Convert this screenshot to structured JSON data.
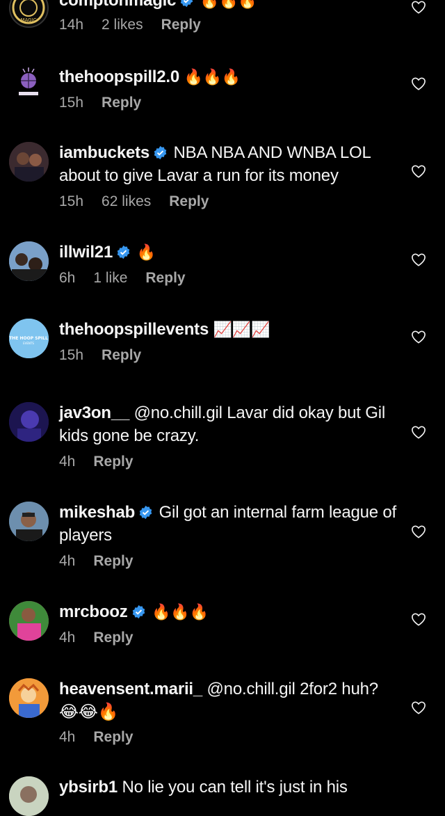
{
  "comments": [
    {
      "username": "comptonmagic",
      "verified": true,
      "text": "🔥🔥🔥",
      "time": "14h",
      "likes": "2 likes",
      "reply": "Reply",
      "avatar": {
        "kind": "crest",
        "bg": "#0a0a0a",
        "label": "MAGIC"
      }
    },
    {
      "username": "thehoopspill2.0",
      "verified": false,
      "text": "🔥🔥🔥",
      "time": "15h",
      "likes": "",
      "reply": "Reply",
      "avatar": {
        "kind": "ball",
        "bg": "#000000"
      }
    },
    {
      "username": "iambuckets",
      "verified": true,
      "text": "NBA NBA AND WNBA LOL about to give Lavar a run for its money",
      "time": "15h",
      "likes": "62 likes",
      "reply": "Reply",
      "avatar": {
        "kind": "photo",
        "bg": "#3b2a2f"
      }
    },
    {
      "username": "illwil21",
      "verified": true,
      "text": "🔥",
      "time": "6h",
      "likes": "1 like",
      "reply": "Reply",
      "avatar": {
        "kind": "photo",
        "bg": "#7aa0c8"
      }
    },
    {
      "username": "thehoopspillevents",
      "verified": false,
      "text": "📈📈📈",
      "time": "15h",
      "likes": "",
      "reply": "Reply",
      "avatar": {
        "kind": "text",
        "bg": "#7fc4ef",
        "label": "THE HOOP SPILL"
      }
    },
    {
      "username": "jav3on__",
      "verified": false,
      "text": "@no.chill.gil Lavar did okay but Gil kids gone be crazy.",
      "time": "4h",
      "likes": "",
      "reply": "Reply",
      "avatar": {
        "kind": "photo",
        "bg": "#2a1f6a"
      }
    },
    {
      "username": "mikeshab",
      "verified": true,
      "text": "Gil got an internal farm league of players",
      "time": "4h",
      "likes": "",
      "reply": "Reply",
      "avatar": {
        "kind": "photo",
        "bg": "#4a6a8a"
      }
    },
    {
      "username": "mrcbooz",
      "verified": true,
      "text": "🔥🔥🔥",
      "time": "4h",
      "likes": "",
      "reply": "Reply",
      "avatar": {
        "kind": "photo",
        "bg": "#d83a8a"
      }
    },
    {
      "username": "heavensent.marii_",
      "verified": false,
      "text": "@no.chill.gil 2for2 huh? 😂😂🔥",
      "time": "4h",
      "likes": "",
      "reply": "Reply",
      "avatar": {
        "kind": "cartoon",
        "bg": "#f28a2e"
      }
    },
    {
      "username": "ybsirb1",
      "verified": false,
      "text": "No lie you can tell it's just in his",
      "time": "",
      "likes": "",
      "reply": "",
      "avatar": {
        "kind": "photo",
        "bg": "#c9d4c0"
      }
    }
  ],
  "colors": {
    "background": "#000000",
    "text": "#f5f5f5",
    "muted": "#a8a8a8",
    "verified": "#3797f0"
  }
}
